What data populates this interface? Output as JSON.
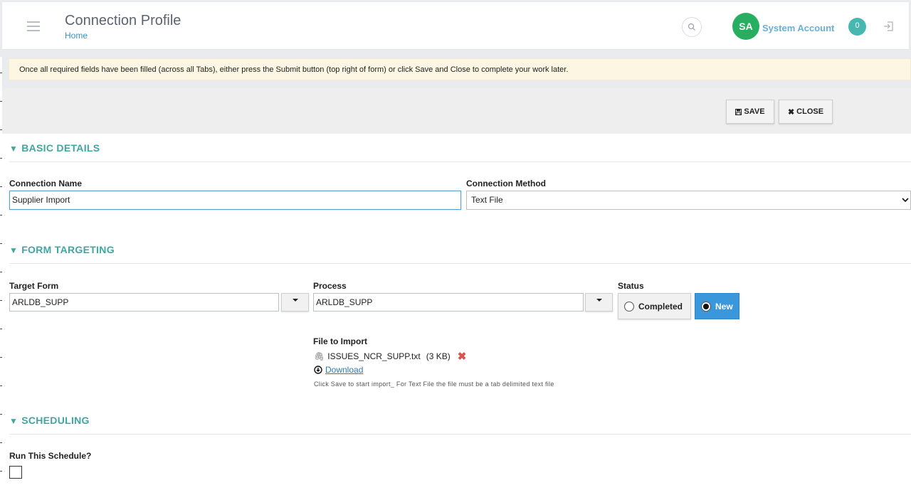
{
  "header": {
    "title": "Connection Profile",
    "breadcrumb": "Home",
    "avatar_initials": "SA",
    "account_name": "System Account",
    "notification_count": "0"
  },
  "notice": {
    "text": "Once all required fields have been filled (across all Tabs), either press the Submit button (top right of form) or click Save and Close to complete your work later."
  },
  "toolbar": {
    "save_label": "SAVE",
    "close_label": "CLOSE"
  },
  "sections": {
    "basic": {
      "title": "BASIC DETAILS",
      "connection_name_label": "Connection Name",
      "connection_name_value": "Supplier Import",
      "connection_method_label": "Connection Method",
      "connection_method_value": "Text File"
    },
    "targeting": {
      "title": "FORM TARGETING",
      "target_form_label": "Target Form",
      "target_form_value": "ARLDB_SUPP",
      "process_label": "Process",
      "process_value": "ARLDB_SUPP",
      "status_label": "Status",
      "status_options": [
        "Completed",
        "New"
      ],
      "status_selected": "New",
      "file_label": "File to Import",
      "file_name": "ISSUES_NCR_SUPP.txt",
      "file_size": "(3 KB)",
      "download_label": "Download",
      "hint": "Click Save to start import_ For Text File the file must be a tab delimited text file"
    },
    "scheduling": {
      "title": "SCHEDULING",
      "run_label": "Run This Schedule?",
      "run_checked": false
    }
  },
  "colors": {
    "accent_teal": "#3fa6a0",
    "avatar_green": "#27ae60",
    "selected_blue": "#3a97dc",
    "delete_red": "#d9534f"
  },
  "icons": {
    "menu": "hamburger-icon",
    "search": "search-icon",
    "logout": "logout-icon",
    "save": "floppy-icon",
    "close": "x-icon",
    "attachment": "paperclip-icon",
    "download": "download-circle-icon",
    "remove": "red-x-icon"
  }
}
